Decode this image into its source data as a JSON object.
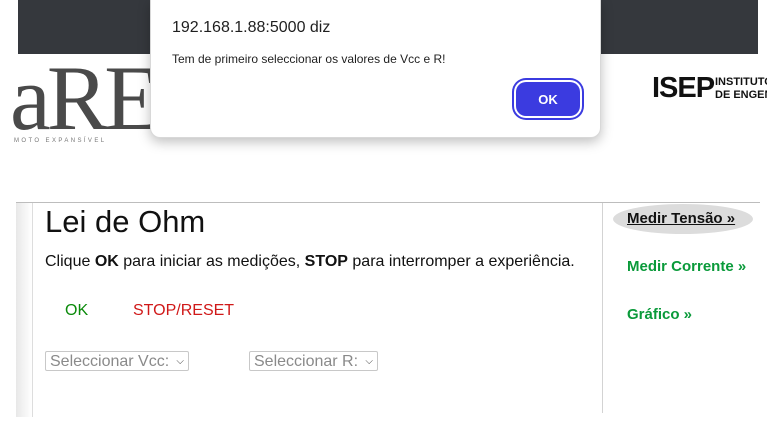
{
  "header": {
    "logo_left_text": "aRE",
    "logo_left_sub": "MOTO EXPANSÍVEL",
    "logo_right_big": "ISEP",
    "logo_right_small_1": "INSTITUTO",
    "logo_right_small_2": "DE ENGENHARIA"
  },
  "main": {
    "title": "Lei de Ohm",
    "instr_1": "Clique ",
    "instr_ok": "OK",
    "instr_2": " para iniciar as medições, ",
    "instr_stop": "STOP",
    "instr_3": " para interromper a experiência.",
    "ok_label": "OK",
    "stop_label": "STOP/RESET",
    "select_vcc": "Seleccionar Vcc:",
    "select_r": "Seleccionar R:"
  },
  "nav": {
    "items": [
      {
        "label": "Medir Tensão »"
      },
      {
        "label": "Medir Corrente »"
      },
      {
        "label": "Gráfico »"
      }
    ]
  },
  "dialog": {
    "title": "192.168.1.88:5000 diz",
    "message": "Tem de primeiro seleccionar os valores de Vcc e R!",
    "ok_label": "OK"
  },
  "colors": {
    "ok_green": "#0a8a0a",
    "stop_red": "#d01818",
    "nav_green": "#0a9a3a",
    "dialog_button": "#3b3be0",
    "topbar": "#35383d"
  }
}
